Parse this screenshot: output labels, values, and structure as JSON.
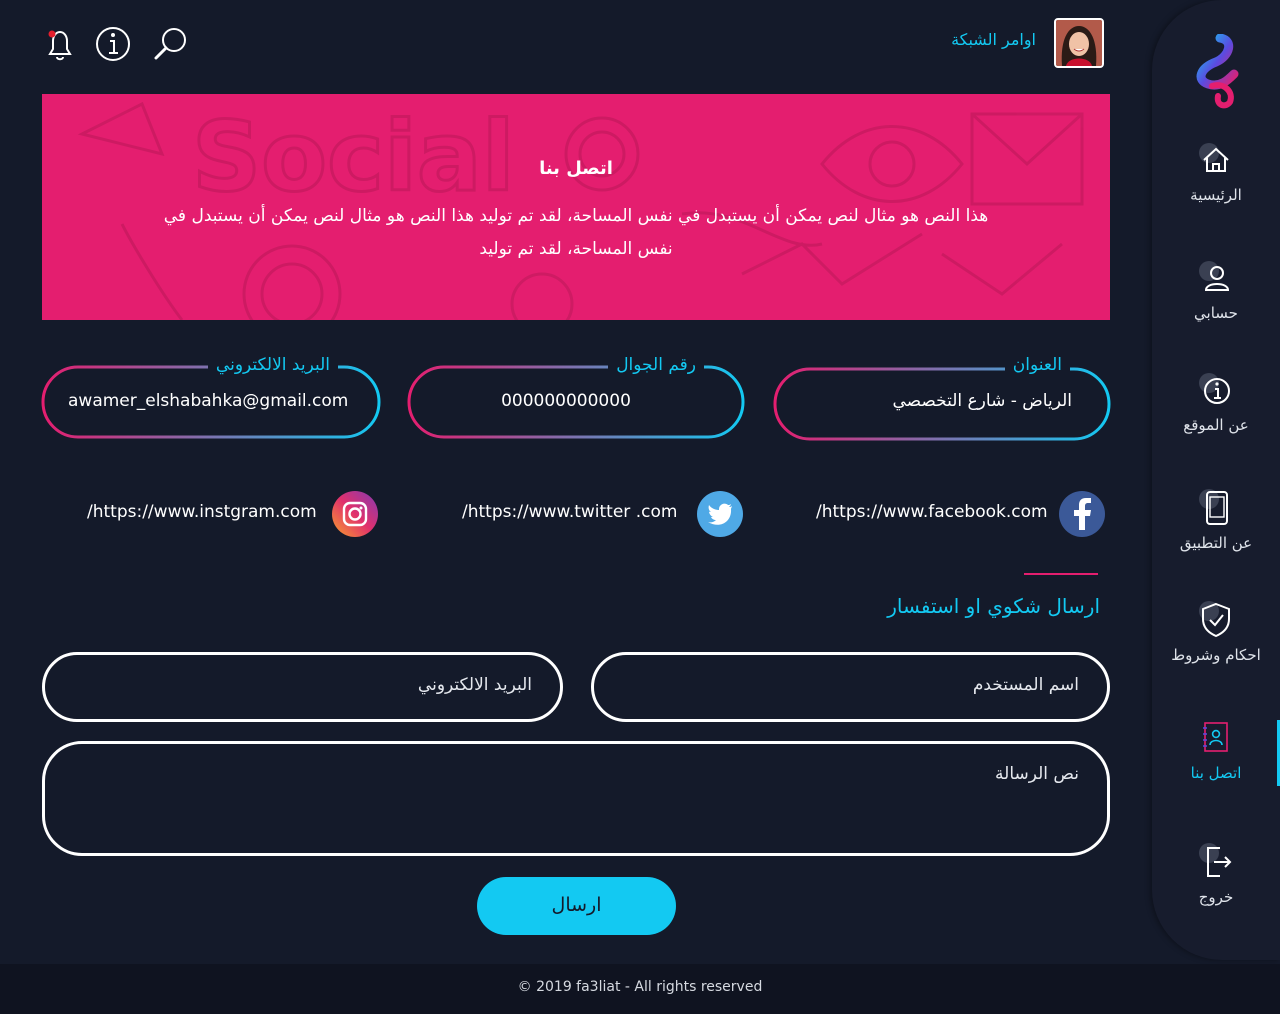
{
  "header": {
    "username": "اوامر الشبكة",
    "icons": [
      "notification-bell-icon",
      "info-icon",
      "search-icon"
    ],
    "notification_dot_color": "#e41e2d"
  },
  "sidebar": {
    "items": [
      {
        "label": "الرئيسية",
        "icon": "home-icon"
      },
      {
        "label": "حسابي",
        "icon": "user-icon"
      },
      {
        "label": "عن الموقع",
        "icon": "info-icon"
      },
      {
        "label": "عن التطبيق",
        "icon": "mobile-icon"
      },
      {
        "label": "احكام وشروط",
        "icon": "shield-check-icon"
      },
      {
        "label": "اتصل بنا",
        "icon": "contact-book-icon",
        "active": true
      },
      {
        "label": "خروج",
        "icon": "logout-icon"
      }
    ]
  },
  "banner": {
    "title": "اتصل بنا",
    "text": "هذا النص هو مثال لنص يمكن أن يستبدل في نفس المساحة، لقد تم توليد هذا النص هو مثال لنص يمكن أن يستبدل في نفس المساحة، لقد تم توليد",
    "background_color": "#e41e6f"
  },
  "contact_info": {
    "address": {
      "label": "العنوان",
      "value": "الرياض - شارع التخصصي"
    },
    "phone": {
      "label": "رقم الجوال",
      "value": "000000000000"
    },
    "email": {
      "label": "البريد الالكتروني",
      "value": "awamer_elshabahka@gmail.com"
    }
  },
  "social": {
    "facebook": "/https://www.facebook.com",
    "twitter": "/https://www.twitter .com",
    "instagram": "/https://www.instgram.com"
  },
  "form": {
    "title": "ارسال شكوي او استفسار",
    "username_placeholder": "اسم المستخدم",
    "email_placeholder": "البريد الالكتروني",
    "message_placeholder": "نص الرسالة",
    "submit_label": "ارسال"
  },
  "footer": {
    "copyright": "© 2019 fa3liat - All rights reserved"
  },
  "colors": {
    "accent_cyan": "#13c9f2",
    "accent_pink": "#e41e6f",
    "background": "#141a2a"
  }
}
